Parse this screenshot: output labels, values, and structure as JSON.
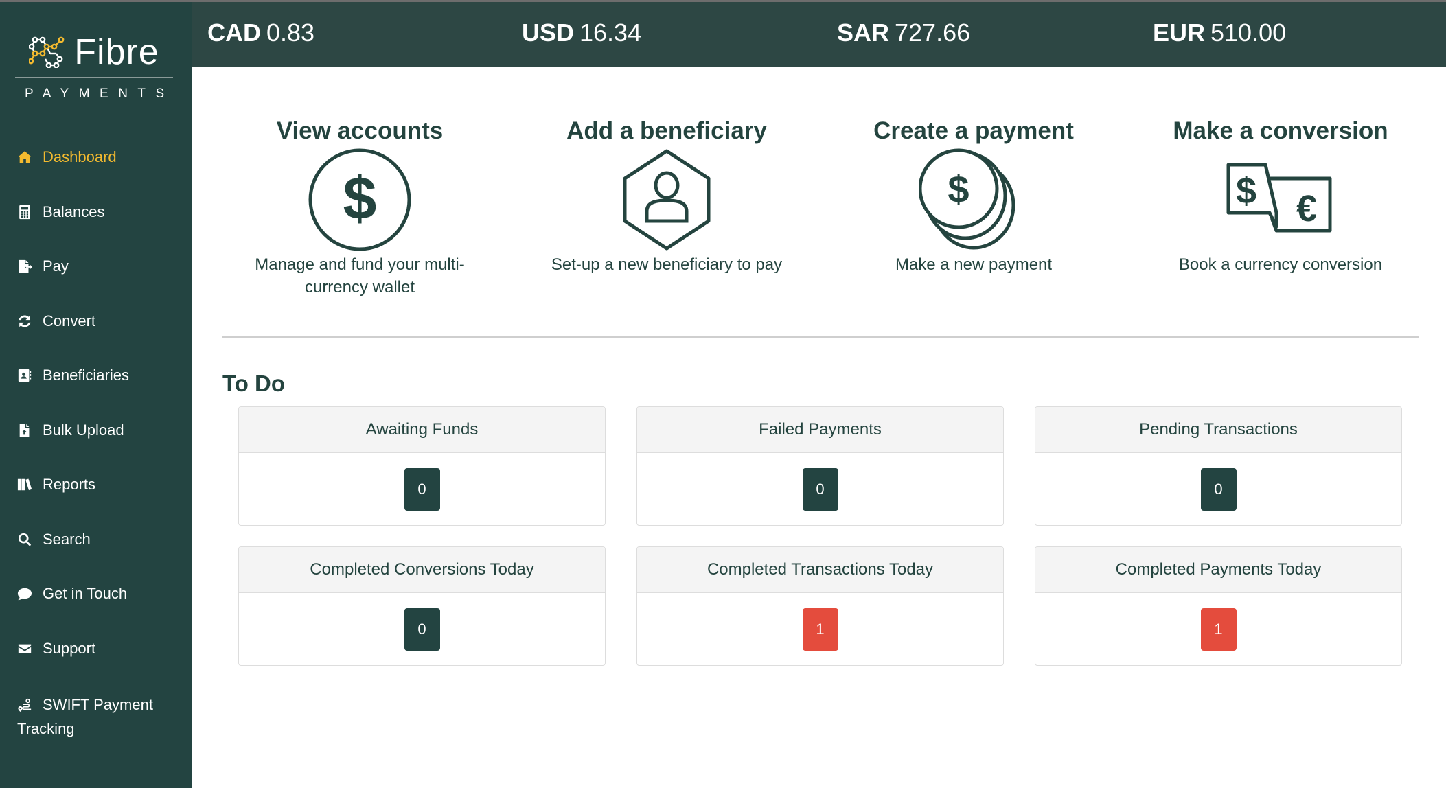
{
  "brand": {
    "name": "Fibre",
    "subtitle": "PAYMENTS",
    "colors": {
      "sidebar": "#234441",
      "topbar": "#2d4744",
      "accent": "#f3ba2f",
      "text_dark": "#24443f",
      "badge_neutral": "#234441",
      "badge_alert": "#e44c3d"
    }
  },
  "sidebar": {
    "items": [
      {
        "label": "Dashboard",
        "icon": "home-icon",
        "active": true
      },
      {
        "label": "Balances",
        "icon": "calculator-icon"
      },
      {
        "label": "Pay",
        "icon": "file-export-icon"
      },
      {
        "label": "Convert",
        "icon": "sync-icon"
      },
      {
        "label": "Beneficiaries",
        "icon": "address-book-icon"
      },
      {
        "label": "Bulk Upload",
        "icon": "file-upload-icon"
      },
      {
        "label": "Reports",
        "icon": "books-icon"
      },
      {
        "label": "Search",
        "icon": "search-icon"
      },
      {
        "label": "Get in Touch",
        "icon": "comment-icon"
      },
      {
        "label": "Support",
        "icon": "envelope-icon"
      },
      {
        "label": "SWIFT Payment Tracking",
        "icon": "route-icon"
      }
    ]
  },
  "balances": [
    {
      "currency": "CAD",
      "amount": "0.83"
    },
    {
      "currency": "USD",
      "amount": "16.34"
    },
    {
      "currency": "SAR",
      "amount": "727.66"
    },
    {
      "currency": "EUR",
      "amount": "510.00"
    }
  ],
  "actions": [
    {
      "title": "View accounts",
      "description": "Manage and fund your multi-currency wallet",
      "icon": "dollar-circle-icon"
    },
    {
      "title": "Add a beneficiary",
      "description": "Set-up a new beneficiary to pay",
      "icon": "user-hexagon-icon"
    },
    {
      "title": "Create a payment",
      "description": "Make a new payment",
      "icon": "coins-icon"
    },
    {
      "title": "Make a conversion",
      "description": "Book a currency conversion",
      "icon": "currency-exchange-icon"
    }
  ],
  "todo": {
    "title": "To Do",
    "cards": [
      {
        "label": "Awaiting Funds",
        "count": "0",
        "status": "neutral"
      },
      {
        "label": "Failed Payments",
        "count": "0",
        "status": "neutral"
      },
      {
        "label": "Pending Transactions",
        "count": "0",
        "status": "neutral"
      },
      {
        "label": "Completed Conversions Today",
        "count": "0",
        "status": "neutral"
      },
      {
        "label": "Completed Transactions Today",
        "count": "1",
        "status": "alert"
      },
      {
        "label": "Completed Payments Today",
        "count": "1",
        "status": "alert"
      }
    ]
  }
}
